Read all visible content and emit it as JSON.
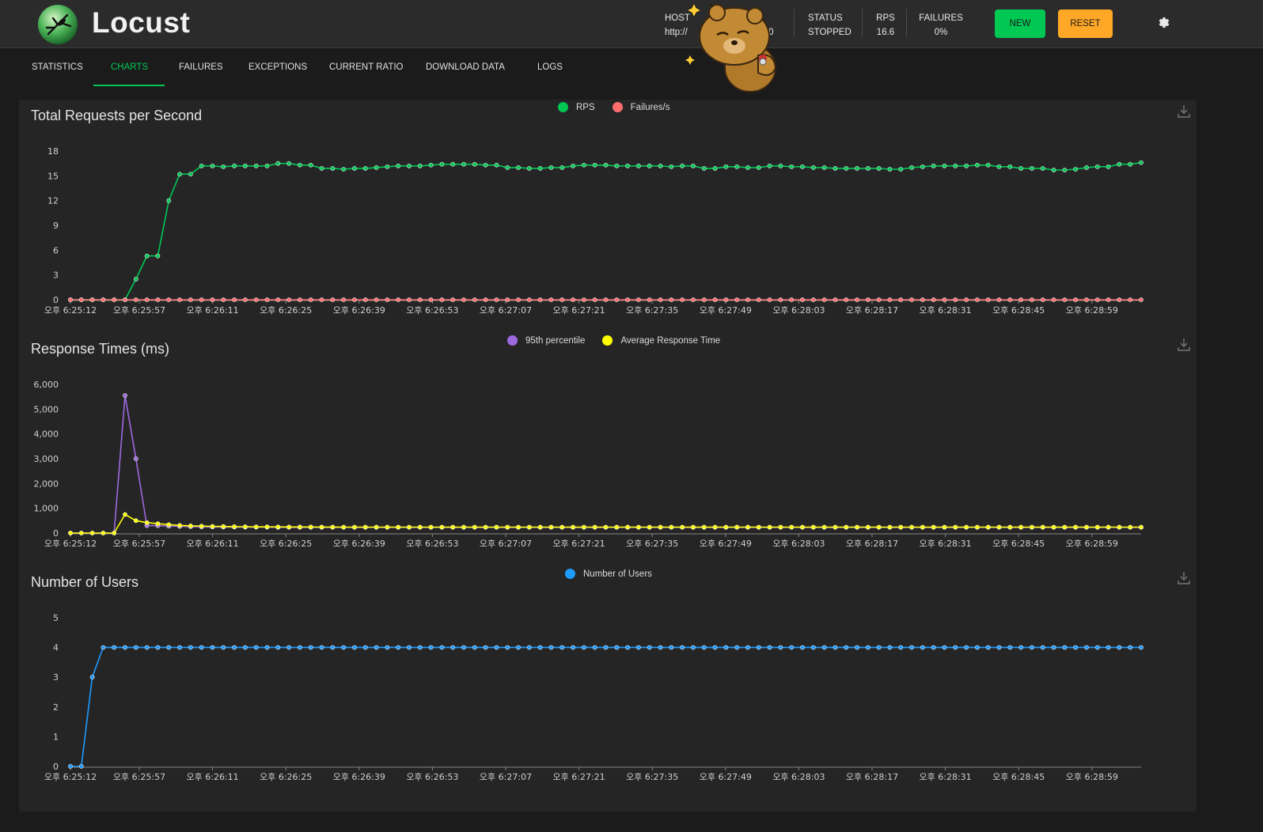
{
  "header": {
    "brand": "Locust",
    "host_label": "HOST",
    "host_value": "http://",
    "host_value_tail": "00",
    "status_label": "STATUS",
    "status_value": "STOPPED",
    "rps_label": "RPS",
    "rps_value": "16.6",
    "failures_label": "FAILURES",
    "failures_value": "0%",
    "new_button": "NEW",
    "reset_button": "RESET"
  },
  "tabs": [
    {
      "label": "STATISTICS",
      "active": false
    },
    {
      "label": "CHARTS",
      "active": true
    },
    {
      "label": "FAILURES",
      "active": false
    },
    {
      "label": "EXCEPTIONS",
      "active": false
    },
    {
      "label": "CURRENT RATIO",
      "active": false
    },
    {
      "label": "DOWNLOAD DATA",
      "active": false
    },
    {
      "label": "LOGS",
      "active": false
    }
  ],
  "colors": {
    "rps": "#00c853",
    "failures": "#ff6d6d",
    "p95": "#9c6ade",
    "avg": "#ffff00",
    "users": "#1e9bff",
    "accent": "#00c853"
  },
  "chart_data": [
    {
      "type": "line",
      "title": "Total Requests per Second",
      "x_tick_labels": [
        "오후 6:25:12",
        "오후 6:25:57",
        "오후 6:26:11",
        "오후 6:26:25",
        "오후 6:26:39",
        "오후 6:26:53",
        "오후 6:27:07",
        "오후 6:27:21",
        "오후 6:27:35",
        "오후 6:27:49",
        "오후 6:28:03",
        "오후 6:28:17",
        "오후 6:28:31",
        "오후 6:28:45",
        "오후 6:28:59"
      ],
      "y_ticks": [
        "0",
        "3",
        "6",
        "9",
        "12",
        "15",
        "18"
      ],
      "ylim": [
        0,
        18
      ],
      "legend": "top-center",
      "series": [
        {
          "name": "RPS",
          "color_key": "rps",
          "values": [
            0,
            0,
            0,
            0,
            0,
            0,
            2.5,
            5.3,
            5.3,
            12,
            15.2,
            15.2,
            16.2,
            16.2,
            16.1,
            16.2,
            16.2,
            16.2,
            16.2,
            16.5,
            16.5,
            16.3,
            16.3,
            15.9,
            15.9,
            15.8,
            15.9,
            15.9,
            16.0,
            16.1,
            16.2,
            16.2,
            16.2,
            16.3,
            16.4,
            16.4,
            16.4,
            16.4,
            16.3,
            16.3,
            16.0,
            16.0,
            15.9,
            15.9,
            16.0,
            16.0,
            16.2,
            16.3,
            16.3,
            16.3,
            16.2,
            16.2,
            16.2,
            16.2,
            16.2,
            16.1,
            16.2,
            16.2,
            15.9,
            15.9,
            16.1,
            16.1,
            16.0,
            16.0,
            16.2,
            16.2,
            16.1,
            16.1,
            16.0,
            16.0,
            15.9,
            15.9,
            15.9,
            15.9,
            15.9,
            15.8,
            15.8,
            16.0,
            16.1,
            16.2,
            16.2,
            16.2,
            16.2,
            16.3,
            16.3,
            16.1,
            16.1,
            15.9,
            15.9,
            15.9,
            15.7,
            15.7,
            15.8,
            16.0,
            16.1,
            16.1,
            16.4,
            16.4,
            16.6
          ]
        },
        {
          "name": "Failures/s",
          "color_key": "failures",
          "values": [
            0,
            0,
            0,
            0,
            0,
            0,
            0,
            0,
            0,
            0,
            0,
            0,
            0,
            0,
            0,
            0,
            0,
            0,
            0,
            0,
            0,
            0,
            0,
            0,
            0,
            0,
            0,
            0,
            0,
            0,
            0,
            0,
            0,
            0,
            0,
            0,
            0,
            0,
            0,
            0,
            0,
            0,
            0,
            0,
            0,
            0,
            0,
            0,
            0,
            0,
            0,
            0,
            0,
            0,
            0,
            0,
            0,
            0,
            0,
            0,
            0,
            0,
            0,
            0,
            0,
            0,
            0,
            0,
            0,
            0,
            0,
            0,
            0,
            0,
            0,
            0,
            0,
            0,
            0,
            0,
            0,
            0,
            0,
            0,
            0,
            0,
            0,
            0,
            0,
            0,
            0,
            0,
            0,
            0,
            0,
            0,
            0,
            0,
            0
          ]
        }
      ]
    },
    {
      "type": "line",
      "title": "Response Times (ms)",
      "x_tick_labels": [
        "오후 6:25:12",
        "오후 6:25:57",
        "오후 6:26:11",
        "오후 6:26:25",
        "오후 6:26:39",
        "오후 6:26:53",
        "오후 6:27:07",
        "오후 6:27:21",
        "오후 6:27:35",
        "오후 6:27:49",
        "오후 6:28:03",
        "오후 6:28:17",
        "오후 6:28:31",
        "오후 6:28:45",
        "오후 6:28:59"
      ],
      "y_ticks": [
        "0",
        "1,000",
        "2,000",
        "3,000",
        "4,000",
        "5,000",
        "6,000"
      ],
      "ylim": [
        0,
        6000
      ],
      "legend": "top-center",
      "series": [
        {
          "name": "95th percentile",
          "color_key": "p95",
          "values": [
            0,
            0,
            0,
            0,
            0,
            5550,
            3000,
            300,
            300,
            280,
            270,
            260,
            250,
            245,
            240,
            240,
            235,
            235,
            235,
            230,
            230,
            230,
            230,
            230,
            230,
            230,
            230,
            230,
            230,
            230,
            230,
            230,
            230,
            230,
            230,
            230,
            230,
            230,
            230,
            230,
            230,
            230,
            230,
            230,
            230,
            230,
            230,
            230,
            230,
            230,
            230,
            230,
            230,
            230,
            230,
            230,
            230,
            230,
            230,
            230,
            230,
            230,
            230,
            230,
            230,
            230,
            230,
            230,
            230,
            230,
            230,
            230,
            230,
            230,
            230,
            230,
            230,
            230,
            230,
            230,
            230,
            230,
            230,
            230,
            230,
            230,
            230,
            230,
            230,
            230,
            230,
            230,
            230,
            230,
            230,
            230,
            230,
            230,
            230
          ]
        },
        {
          "name": "Average Response Time",
          "color_key": "avg",
          "values": [
            0,
            0,
            0,
            0,
            0,
            750,
            500,
            420,
            380,
            340,
            310,
            290,
            280,
            270,
            265,
            260,
            255,
            250,
            250,
            248,
            245,
            245,
            245,
            243,
            242,
            240,
            240,
            240,
            240,
            240,
            240,
            240,
            240,
            240,
            240,
            240,
            240,
            240,
            240,
            240,
            240,
            240,
            240,
            240,
            240,
            240,
            240,
            240,
            240,
            240,
            240,
            240,
            240,
            240,
            240,
            240,
            240,
            240,
            240,
            240,
            240,
            240,
            240,
            240,
            240,
            240,
            240,
            240,
            240,
            240,
            240,
            240,
            240,
            240,
            240,
            240,
            240,
            240,
            240,
            240,
            240,
            240,
            240,
            240,
            240,
            240,
            240,
            240,
            240,
            240,
            240,
            240,
            240,
            240,
            240,
            240,
            240,
            240,
            240
          ]
        }
      ]
    },
    {
      "type": "line",
      "title": "Number of Users",
      "x_tick_labels": [
        "오후 6:25:12",
        "오후 6:25:57",
        "오후 6:26:11",
        "오후 6:26:25",
        "오후 6:26:39",
        "오후 6:26:53",
        "오후 6:27:07",
        "오후 6:27:21",
        "오후 6:27:35",
        "오후 6:27:49",
        "오후 6:28:03",
        "오후 6:28:17",
        "오후 6:28:31",
        "오후 6:28:45",
        "오후 6:28:59"
      ],
      "y_ticks": [
        "0",
        "1",
        "2",
        "3",
        "4",
        "5"
      ],
      "ylim": [
        0,
        5
      ],
      "legend": "top-center",
      "series": [
        {
          "name": "Number of Users",
          "color_key": "users",
          "values": [
            0,
            0,
            3,
            4,
            4,
            4,
            4,
            4,
            4,
            4,
            4,
            4,
            4,
            4,
            4,
            4,
            4,
            4,
            4,
            4,
            4,
            4,
            4,
            4,
            4,
            4,
            4,
            4,
            4,
            4,
            4,
            4,
            4,
            4,
            4,
            4,
            4,
            4,
            4,
            4,
            4,
            4,
            4,
            4,
            4,
            4,
            4,
            4,
            4,
            4,
            4,
            4,
            4,
            4,
            4,
            4,
            4,
            4,
            4,
            4,
            4,
            4,
            4,
            4,
            4,
            4,
            4,
            4,
            4,
            4,
            4,
            4,
            4,
            4,
            4,
            4,
            4,
            4,
            4,
            4,
            4,
            4,
            4,
            4,
            4,
            4,
            4,
            4,
            4,
            4,
            4,
            4,
            4,
            4,
            4,
            4,
            4,
            4,
            4
          ]
        }
      ]
    }
  ]
}
